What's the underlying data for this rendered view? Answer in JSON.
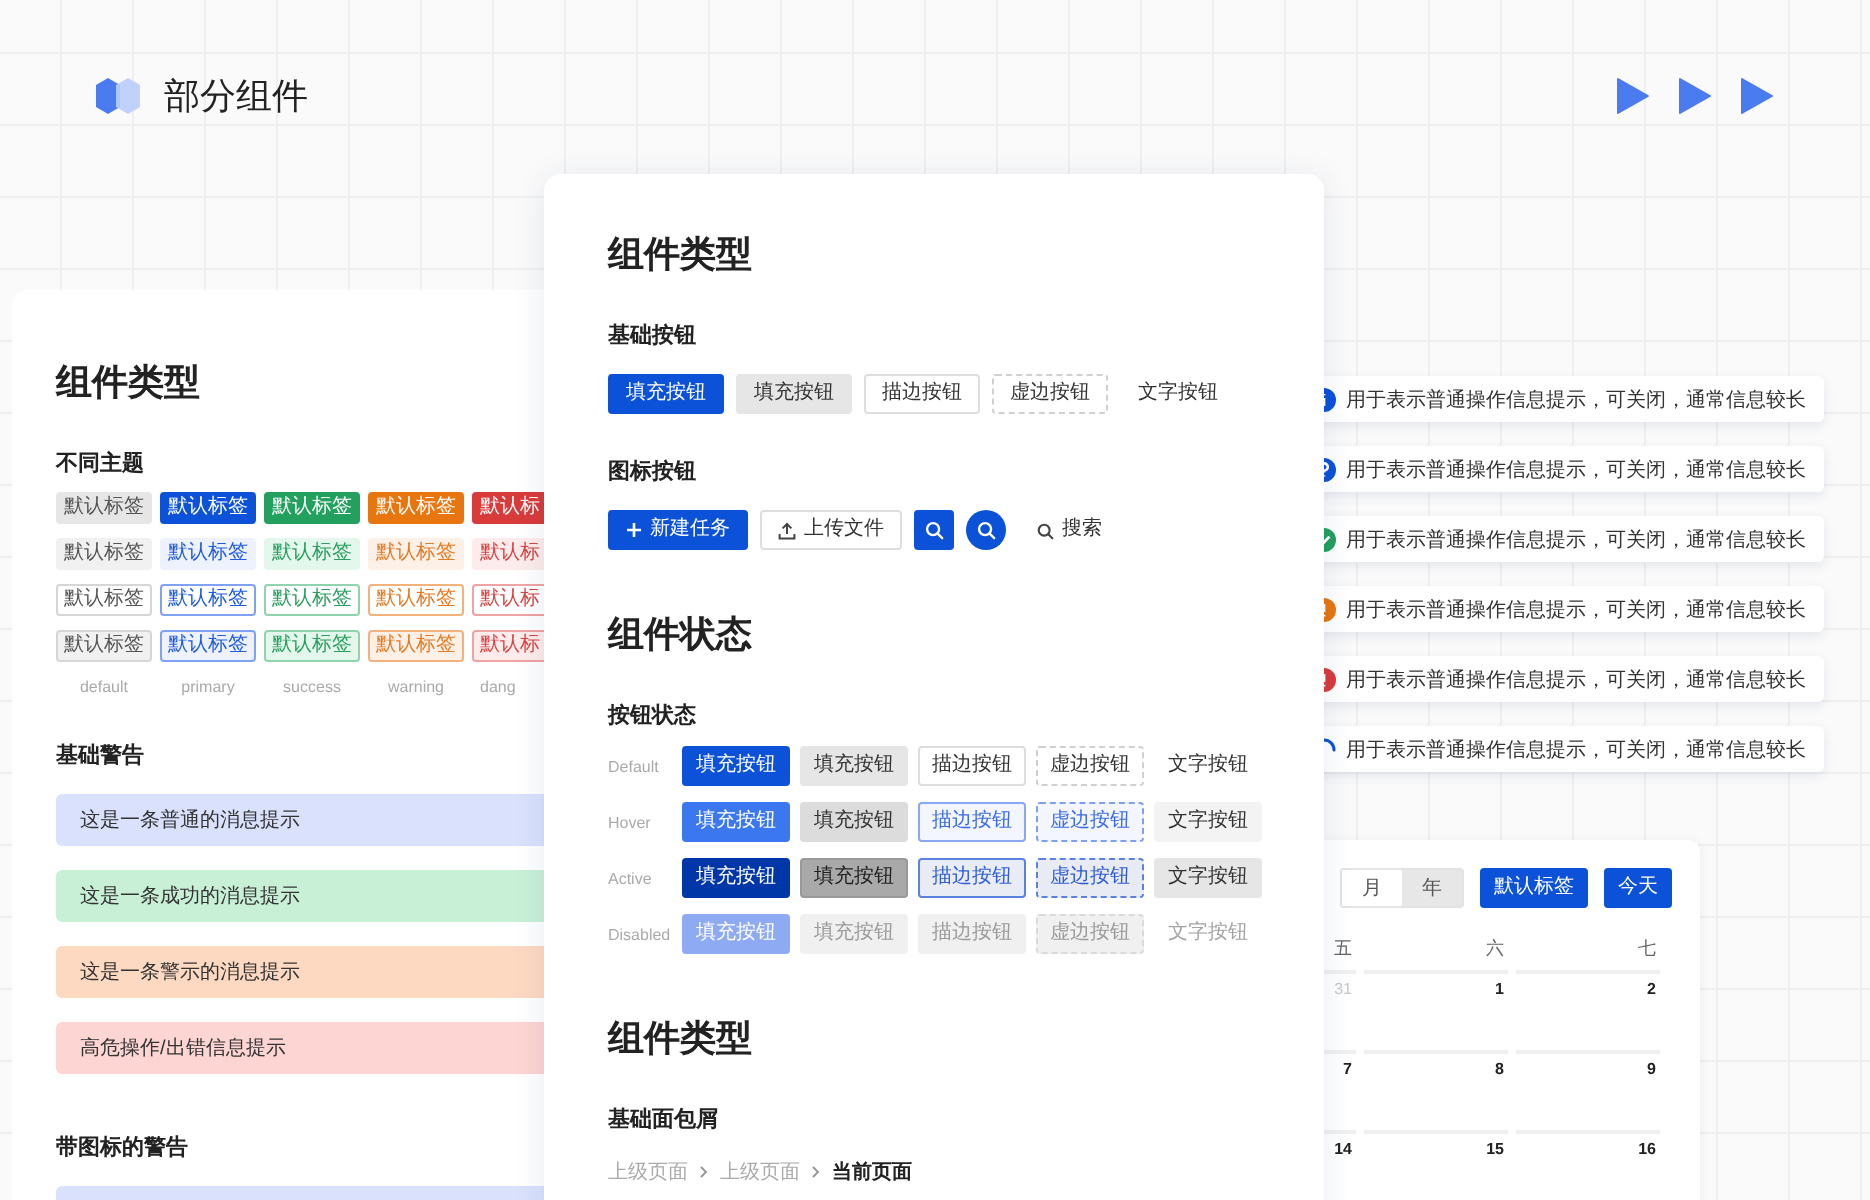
{
  "header": {
    "title": "部分组件"
  },
  "left_card": {
    "title": "组件类型",
    "tags_heading": "不同主题",
    "tag_rows": [
      {
        "kind": "dark",
        "tags": [
          {
            "label": "默认标签",
            "kind": "default"
          },
          {
            "label": "默认标签",
            "kind": "primary"
          },
          {
            "label": "默认标签",
            "kind": "success"
          },
          {
            "label": "默认标签",
            "kind": "warning"
          },
          {
            "label": "默认标",
            "kind": "danger"
          }
        ]
      },
      {
        "kind": "light",
        "tags": [
          {
            "label": "默认标签",
            "kind": "default"
          },
          {
            "label": "默认标签",
            "kind": "primary"
          },
          {
            "label": "默认标签",
            "kind": "success"
          },
          {
            "label": "默认标签",
            "kind": "warning"
          },
          {
            "label": "默认标",
            "kind": "danger"
          }
        ]
      },
      {
        "kind": "outline",
        "tags": [
          {
            "label": "默认标签",
            "kind": "default"
          },
          {
            "label": "默认标签",
            "kind": "primary"
          },
          {
            "label": "默认标签",
            "kind": "success"
          },
          {
            "label": "默认标签",
            "kind": "warning"
          },
          {
            "label": "默认标",
            "kind": "danger"
          }
        ]
      },
      {
        "kind": "tinted",
        "tags": [
          {
            "label": "默认标签",
            "kind": "default"
          },
          {
            "label": "默认标签",
            "kind": "primary"
          },
          {
            "label": "默认标签",
            "kind": "success"
          },
          {
            "label": "默认标签",
            "kind": "warning"
          },
          {
            "label": "默认标",
            "kind": "danger"
          }
        ]
      }
    ],
    "theme_labels": [
      "default",
      "primary",
      "success",
      "warning",
      "dang"
    ],
    "alerts_heading": "基础警告",
    "alerts": [
      {
        "kind": "info",
        "text": "这是一条普通的消息提示"
      },
      {
        "kind": "success",
        "text": "这是一条成功的消息提示"
      },
      {
        "kind": "warning",
        "text": "这是一条警示的消息提示"
      },
      {
        "kind": "error",
        "text": "高危操作/出错信息提示"
      }
    ],
    "icon_alerts_heading": "带图标的警告",
    "icon_alerts": [
      {
        "kind": "info"
      }
    ]
  },
  "center_card": {
    "title": "组件类型",
    "basic_heading": "基础按钮",
    "basic_buttons": [
      {
        "label": "填充按钮",
        "kind": "fill"
      },
      {
        "label": "填充按钮",
        "kind": "grey"
      },
      {
        "label": "描边按钮",
        "kind": "outline"
      },
      {
        "label": "虚边按钮",
        "kind": "dashed"
      },
      {
        "label": "文字按钮",
        "kind": "text"
      }
    ],
    "icon_heading": "图标按钮",
    "icon_buttons": [
      {
        "kind": "add",
        "label": "新建任务"
      },
      {
        "kind": "upload",
        "label": "上传文件"
      },
      {
        "kind": "search-square"
      },
      {
        "kind": "search-circle"
      },
      {
        "kind": "search-text",
        "label": "搜索"
      }
    ],
    "state_title": "组件状态",
    "state_heading": "按钮状态",
    "state_rows": [
      {
        "label": "Default",
        "kind": "default",
        "buttons": [
          {
            "label": "填充按钮",
            "kind": "fill"
          },
          {
            "label": "填充按钮",
            "kind": "grey"
          },
          {
            "label": "描边按钮",
            "kind": "outline"
          },
          {
            "label": "虚边按钮",
            "kind": "dashed"
          },
          {
            "label": "文字按钮",
            "kind": "text"
          }
        ]
      },
      {
        "label": "Hover",
        "kind": "hover",
        "buttons": [
          {
            "label": "填充按钮",
            "kind": "fill"
          },
          {
            "label": "填充按钮",
            "kind": "grey"
          },
          {
            "label": "描边按钮",
            "kind": "outline"
          },
          {
            "label": "虚边按钮",
            "kind": "dashed"
          },
          {
            "label": "文字按钮",
            "kind": "text"
          }
        ]
      },
      {
        "label": "Active",
        "kind": "active",
        "buttons": [
          {
            "label": "填充按钮",
            "kind": "fill"
          },
          {
            "label": "填充按钮",
            "kind": "grey"
          },
          {
            "label": "描边按钮",
            "kind": "outline"
          },
          {
            "label": "虚边按钮",
            "kind": "dashed"
          },
          {
            "label": "文字按钮",
            "kind": "text"
          }
        ]
      },
      {
        "label": "Disabled",
        "kind": "disabled",
        "buttons": [
          {
            "label": "填充按钮",
            "kind": "fill"
          },
          {
            "label": "填充按钮",
            "kind": "grey"
          },
          {
            "label": "描边按钮",
            "kind": "outline"
          },
          {
            "label": "虚边按钮",
            "kind": "dashed"
          },
          {
            "label": "文字按钮",
            "kind": "text"
          }
        ]
      }
    ],
    "title_2": "组件类型",
    "breadcrumb_heading": "基础面包屑",
    "breadcrumb": [
      {
        "label": "上级页面",
        "current": false
      },
      {
        "label": "上级页面",
        "current": false
      },
      {
        "label": "当前页面",
        "current": true
      }
    ]
  },
  "notices": [
    {
      "kind": "info",
      "text": "用于表示普通操作信息提示，可关闭，通常信息较长"
    },
    {
      "kind": "help",
      "text": "用于表示普通操作信息提示，可关闭，通常信息较长"
    },
    {
      "kind": "success",
      "text": "用于表示普通操作信息提示，可关闭，通常信息较长"
    },
    {
      "kind": "warning",
      "text": "用于表示普通操作信息提示，可关闭，通常信息较长"
    },
    {
      "kind": "error",
      "text": "用于表示普通操作信息提示，可关闭，通常信息较长"
    },
    {
      "kind": "loading",
      "text": "用于表示普通操作信息提示，可关闭，通常信息较长"
    }
  ],
  "calendar": {
    "view_options": [
      {
        "label": "月",
        "selected": true
      },
      {
        "label": "年",
        "selected": false
      }
    ],
    "buttons": [
      "默认标签",
      "今天"
    ],
    "weekdays": [
      "五",
      "六",
      "七"
    ],
    "weeks": [
      [
        {
          "day": "31",
          "other_month": true
        },
        {
          "day": "1",
          "other_month": false
        },
        {
          "day": "2",
          "other_month": false
        }
      ],
      [
        {
          "day": "7",
          "other_month": false
        },
        {
          "day": "8",
          "other_month": false
        },
        {
          "day": "9",
          "other_month": false
        }
      ],
      [
        {
          "day": "14",
          "other_month": false
        },
        {
          "day": "15",
          "other_month": false
        },
        {
          "day": "16",
          "other_month": false
        }
      ]
    ]
  }
}
